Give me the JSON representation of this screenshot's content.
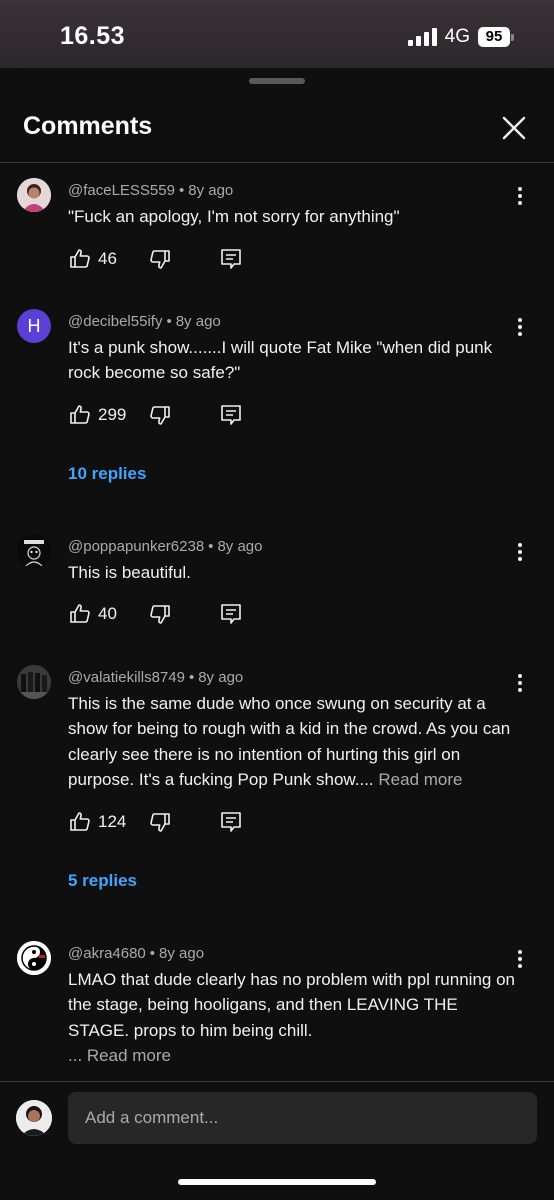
{
  "status_bar": {
    "time": "16.53",
    "network": "4G",
    "battery": "95"
  },
  "header": {
    "title": "Comments"
  },
  "comments": [
    {
      "author": "@faceLESS559",
      "age": "8y ago",
      "text": "\"Fuck an apology, I'm not sorry for anything\"",
      "likes": "46",
      "avatar": "photo"
    },
    {
      "author": "@decibel55ify",
      "age": "8y ago",
      "text": "It's a punk show.......I will quote Fat Mike \"when did punk rock become so safe?\"",
      "likes": "299",
      "replies": "10 replies",
      "avatar_letter": "H",
      "avatar_color": "#5b3fd6"
    },
    {
      "author": "@poppapunker6238",
      "age": "8y ago",
      "text": "This is beautiful.",
      "likes": "40",
      "avatar": "drawing"
    },
    {
      "author": "@valatiekills8749",
      "age": "8y ago",
      "text": "This is the same dude who once swung on security at a show for being to rough with a kid in the crowd. As you can clearly see there is no intention of hurting this girl on purpose. It's a fucking Pop Punk show....",
      "read_more": " Read more",
      "likes": "124",
      "replies": "5 replies",
      "avatar": "band-photo"
    },
    {
      "author": "@akra4680",
      "age": "8y ago",
      "text": "LMAO that dude clearly has no problem with ppl running on the stage, being hooligans, and then LEAVING THE STAGE. props to him being chill.",
      "read_more": "... Read more",
      "avatar": "yin-yang"
    }
  ],
  "composer": {
    "placeholder": "Add a comment..."
  },
  "colors": {
    "background": "#0f0f0f",
    "link": "#3ea6ff",
    "secondary_text": "#aaaaaa"
  }
}
